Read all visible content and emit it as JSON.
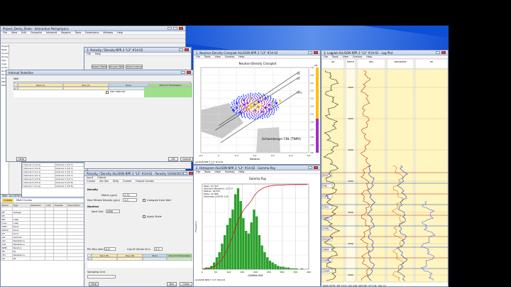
{
  "app": {
    "title": "Project_Demo_Shale - Interactive Petrophysics",
    "menu": [
      "File",
      "View",
      "Edit",
      "Compute",
      "Interpret",
      "Reports",
      "Tools",
      "Extensions",
      "Window",
      "Help"
    ]
  },
  "well_manager": {
    "tabs": [
      "Curves",
      "Multi Curves"
    ],
    "well_label": "Well: ALLISON NPR 3 \"L3\" #14-02",
    "columns": [
      "Name",
      "Type",
      "Detected",
      "Unit",
      "Sample",
      "Description"
    ],
    "rows": [
      [
        "",
        "",
        "",
        "",
        "",
        "",
        "0"
      ],
      [
        "BT",
        "Voltage",
        "",
        "",
        "",
        "",
        "0"
      ],
      [
        "BT",
        "",
        "",
        "",
        "",
        "",
        "0"
      ],
      [
        "BIT",
        "Calip",
        "",
        "",
        "",
        "",
        "0"
      ],
      [
        "CALI",
        "Calip",
        "",
        "",
        "",
        "",
        "0"
      ],
      [
        "DEN",
        "Dens",
        "",
        "",
        "",
        "",
        "0"
      ],
      [
        "DRHO",
        "Dens",
        "",
        "",
        "",
        "",
        "0"
      ],
      [
        "DT",
        "Sonic",
        "",
        "",
        "",
        "",
        "0"
      ],
      [
        "GR",
        "Gamma",
        "",
        "",
        "",
        "",
        "0"
      ],
      [
        "ILD",
        "Resistance",
        "",
        "",
        "",
        "",
        "0"
      ],
      [
        "ILM",
        "Resistance",
        "",
        "",
        "",
        "",
        "0"
      ],
      [
        "NPHI",
        "Neutron",
        "",
        "",
        "",
        "",
        "0"
      ],
      [
        "PE",
        "Pe",
        "",
        "",
        "",
        "",
        "0"
      ],
      [
        "SFL",
        "Resistance",
        "",
        "",
        "",
        "",
        "0"
      ],
      [
        "SP",
        "SP",
        "",
        "",
        "",
        "",
        "0"
      ]
    ],
    "side_items": [
      "Project",
      "Wells",
      "Curves",
      "Zones",
      "Tops",
      "Logs",
      "Cores",
      "Zones",
      "Facies",
      "Groups",
      "Marker",
      "Test"
    ]
  },
  "interval_dialog": {
    "title": "Interval Selection",
    "well_label": "Well",
    "columns": [
      "",
      "Start (1)",
      "Stop (1)",
      "Zone",
      "Zone for Parameters"
    ],
    "row": [
      "1",
      "",
      "",
      "",
      ""
    ],
    "checkbox_label": "Use Interval",
    "buttons": {
      "help": "Help",
      "ok": "OK",
      "cancel": "Cancel"
    },
    "list_rows": [
      [
        "Interval 1 (11.2)",
        "Interval 1 (15.7)"
      ],
      [
        "Interval 2 (11.0)",
        "Interval 2 (15.7)"
      ],
      [
        "Interval 3 (11.1)",
        "Interval 3 (15.7)"
      ],
      [
        "Interval 4 (12.1)",
        "Interval 4 (15.7)"
      ],
      [
        "Interval 5 (13.4)",
        "Interval 5 (15.7)"
      ],
      [
        "Interval 6 (13.2)",
        "Interval 6 (15.8)"
      ],
      [
        "Interval 7 (11.2)",
        "Interval 7 (15.8)"
      ]
    ]
  },
  "porosity_window": {
    "title": "3. Porosity / Density NPR 3 \"L3\" #14-02",
    "buttons": [
      "Select Wells",
      "Remove Wells",
      "Select Interval"
    ]
  },
  "porosity_dialog": {
    "title": "Porosity / Density ALLISON NPR 3 \"L3\" #14-02 - Porosity 10/04/2017 12:21:39 AM",
    "tabs": [
      "Input",
      "Output"
    ],
    "subtabs": [
      "Curves",
      "Ser Set",
      "SGIp",
      "Curves",
      "Output Curves"
    ],
    "section_density": "Density",
    "matrix_label": "Matrix (g/cc)",
    "matrix_value": "2.71",
    "mud_label": "Mud Filtrate Density (g/cc)",
    "mud_value": "1.0",
    "neutron_label": "Neutron",
    "neut_label": "Neut Unit",
    "neut_value": "NPHI",
    "check_labels": [
      "Compute from Well",
      "Apply Shale"
    ],
    "phi_label": "Phi Max (dec)",
    "phi_value": "0.6",
    "cap_label": "Cap HI (Shale VCL)",
    "cap_value": "0.3",
    "table_cols": [
      "",
      "Start (ft)",
      "Stop (ft)",
      "Zone",
      "Zone for Parameters"
    ],
    "table_row": [
      "1",
      "",
      "",
      "",
      ""
    ],
    "sampling_label": "Sampling Grid",
    "buttons": {
      "help": "Help",
      "run": "Run",
      "close": "Close"
    }
  },
  "crossplot": {
    "title": "1. Neutron-Density Crossplot ALLISON NPR 3 \"L3\" #14-02",
    "menu": [
      "File",
      "Tools",
      "View",
      "Overlay",
      "Help"
    ],
    "plot_title": "Neutron-Density Crossplot",
    "xlabel": "Neutron",
    "ylabel": "Density",
    "overlay_label": "Schlumberger CNL (TNPH)",
    "lines": [
      "SS",
      "LS",
      "DOL"
    ],
    "info": [
      "ALLISON NPR 3 \"L3\" #14-02",
      "Points plotted 2734",
      "Points in range 2734"
    ],
    "xticks": [
      "-0.1",
      "0",
      "0.1",
      "0.2",
      "0.3",
      "0.4",
      "0.5"
    ],
    "yticks": [
      "1.9",
      "2.0",
      "2.1",
      "2.2",
      "2.3",
      "2.4",
      "2.5",
      "2.6",
      "2.7",
      "2.8",
      "2.9",
      "3.0"
    ],
    "colorbar_label": "GR",
    "colors": {
      "cold": "#3040ff",
      "mid": "#a030c0",
      "hot": "#ffc000"
    }
  },
  "histogram": {
    "title": "2. Histogram ALLISON NPR 3 \"L3\" #14-02 - Gamma Ray",
    "menu": [
      "File",
      "Tools",
      "View",
      "Overlay",
      "Help"
    ],
    "plot_title": "Gamma Ray",
    "xlabel": "GAMMA RAY",
    "ylabel": "Frequency",
    "stats": [
      "Mean: 97.727",
      "Standard Deviation: 52.717",
      "Median: 91.537",
      "Mode: 91.595",
      "Skewness: 0.9976 2.00"
    ],
    "footer": "ALLISON NPR 3 \"L3\" #14-02",
    "xticks": [
      "0",
      "50",
      "100",
      "150",
      "200",
      "250",
      "300",
      "350",
      "400"
    ],
    "bars_color": "#2aa02a",
    "cum_color": "#c02020"
  },
  "logplot": {
    "title": "3. Logplot ALLISON NPR 3 \"L3\" #14-02 - Log Plot",
    "menu": [
      "File",
      "Tools",
      "View",
      "Overlay",
      "Help"
    ],
    "track_headers": [
      "GR",
      "DEPTH",
      "RES",
      "NPHI/RHOB",
      "PE"
    ],
    "depth_labels": [
      "1000",
      "1500",
      "2000",
      "2500",
      "3000",
      "3500",
      "4000"
    ],
    "zones": [
      "MASS",
      "FWB",
      "TOP A",
      "TOP B",
      "ZONE1",
      "ZONE2",
      "BASE C",
      "UPPER",
      "SANDY",
      "LOWER"
    ],
    "footer": "Depth 3477ft  -  PHI: 13.70 - Vsh: 0.48 - SW 0.98 - Vcl: 0.42 - Vwc: 0.1"
  },
  "chart_data": [
    {
      "type": "scatter",
      "title": "Neutron-Density Crossplot",
      "xlabel": "Neutron",
      "ylabel": "Density",
      "xlim": [
        -0.1,
        0.5
      ],
      "ylim": [
        3.0,
        1.9
      ],
      "series": [
        {
          "name": "ALLISON NPR 3 \"L3\" #14-02",
          "x": [
            0.08,
            0.1,
            0.12,
            0.14,
            0.16,
            0.18,
            0.2,
            0.22,
            0.24,
            0.26,
            0.28,
            0.3,
            0.32,
            0.14,
            0.18,
            0.22,
            0.26,
            0.3,
            0.2,
            0.24,
            0.16,
            0.12,
            0.28,
            0.34,
            0.1
          ],
          "y": [
            2.45,
            2.42,
            2.4,
            2.38,
            2.36,
            2.4,
            2.38,
            2.41,
            2.4,
            2.42,
            2.38,
            2.4,
            2.36,
            2.32,
            2.3,
            2.34,
            2.3,
            2.34,
            2.45,
            2.47,
            2.44,
            2.48,
            2.44,
            2.33,
            2.36
          ]
        }
      ],
      "overlay_lines": [
        "SS",
        "LS",
        "DOL"
      ]
    },
    {
      "type": "bar",
      "title": "Gamma Ray",
      "xlabel": "GAMMA RAY",
      "ylabel": "Frequency",
      "xlim": [
        0,
        400
      ],
      "categories": [
        "0",
        "10",
        "20",
        "30",
        "40",
        "50",
        "60",
        "70",
        "80",
        "90",
        "100",
        "110",
        "120",
        "130",
        "140",
        "150",
        "160",
        "170",
        "180",
        "190",
        "200",
        "210",
        "220",
        "230",
        "240",
        "250",
        "260",
        "270",
        "280",
        "290",
        "300",
        "310",
        "320",
        "330",
        "340",
        "350",
        "360",
        "370",
        "380",
        "390"
      ],
      "values": [
        1,
        2,
        2,
        4,
        8,
        14,
        20,
        30,
        40,
        52,
        60,
        70,
        88,
        95,
        80,
        60,
        45,
        42,
        55,
        70,
        62,
        40,
        28,
        20,
        14,
        10,
        8,
        6,
        4,
        3,
        3,
        2,
        2,
        1,
        1,
        1,
        0,
        1,
        0,
        0
      ],
      "series": [
        {
          "name": "Cumulative",
          "values": [
            0,
            0.01,
            0.02,
            0.03,
            0.05,
            0.08,
            0.12,
            0.18,
            0.26,
            0.36,
            0.47,
            0.59,
            0.73,
            0.86,
            0.96,
            1.04,
            1.1,
            1.15,
            1.21,
            1.29,
            1.35,
            1.39,
            1.42,
            1.44,
            1.455,
            1.465,
            1.472,
            1.477,
            1.48,
            1.482,
            1.484,
            1.486,
            1.488,
            1.489,
            1.49,
            1.49,
            1.49,
            1.49,
            1.49,
            1.49
          ]
        }
      ]
    }
  ]
}
